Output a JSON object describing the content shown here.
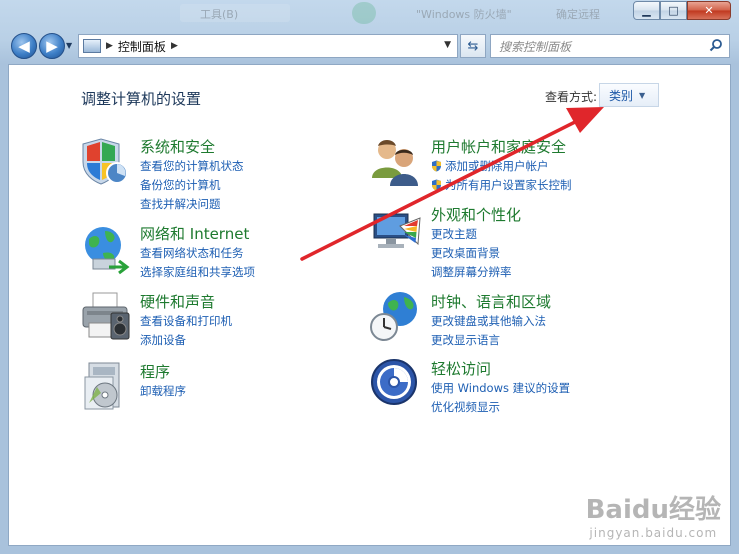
{
  "window": {
    "titlebar_bg_text": [
      "工具(B)",
      "\"Windows 防火墙\"",
      "确定远程"
    ],
    "caption": {
      "minimize": "▁",
      "maximize": "□",
      "close": "✕"
    }
  },
  "nav": {
    "back_icon": "◀",
    "forward_icon": "▶",
    "dropdown_icon": "▼",
    "refresh_icon": "⇆"
  },
  "address": {
    "path": "控制面板",
    "separator": "▶",
    "dropdown_icon": "▼"
  },
  "search": {
    "placeholder": "搜索控制面板"
  },
  "header": {
    "title": "调整计算机的设置",
    "view_by_label": "查看方式:",
    "view_by_value": "类别",
    "view_by_dropdown_icon": "▼"
  },
  "categories_left": [
    {
      "title": "系统和安全",
      "icon": "security-shield-icon",
      "links": [
        "查看您的计算机状态",
        "备份您的计算机",
        "查找并解决问题"
      ]
    },
    {
      "title": "网络和 Internet",
      "icon": "network-globe-icon",
      "links": [
        "查看网络状态和任务",
        "选择家庭组和共享选项"
      ]
    },
    {
      "title": "硬件和声音",
      "icon": "printer-icon",
      "links": [
        "查看设备和打印机",
        "添加设备"
      ]
    },
    {
      "title": "程序",
      "icon": "programs-icon",
      "links": [
        "卸载程序"
      ]
    }
  ],
  "categories_right": [
    {
      "title": "用户帐户和家庭安全",
      "icon": "users-icon",
      "links": [
        "添加或删除用户帐户",
        "为所有用户设置家长控制"
      ]
    },
    {
      "title": "外观和个性化",
      "icon": "appearance-icon",
      "links": [
        "更改主题",
        "更改桌面背景",
        "调整屏幕分辨率"
      ]
    },
    {
      "title": "时钟、语言和区域",
      "icon": "clock-globe-icon",
      "links": [
        "更改键盘或其他输入法",
        "更改显示语言"
      ]
    },
    {
      "title": "轻松访问",
      "icon": "ease-of-access-icon",
      "links": [
        "使用 Windows 建议的设置",
        "优化视频显示"
      ]
    }
  ],
  "watermark": {
    "logo": "Baidu经验",
    "sub": "jingyan.baidu.com"
  },
  "colors": {
    "title_green": "#1e7a2f",
    "link_blue": "#1e5fb3",
    "arrow_red": "#e0262b"
  }
}
